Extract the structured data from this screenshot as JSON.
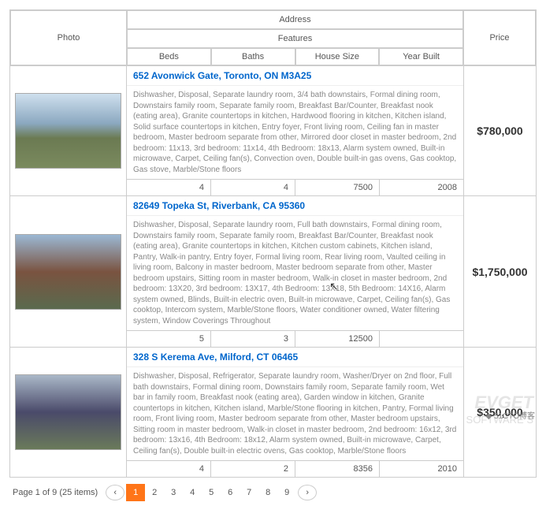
{
  "headers": {
    "photo": "Photo",
    "address": "Address",
    "features": "Features",
    "price": "Price",
    "beds": "Beds",
    "baths": "Baths",
    "house_size": "House Size",
    "year_built": "Year Built"
  },
  "listings": [
    {
      "address": "652 Avonwick Gate, Toronto, ON M3A25",
      "description": "Dishwasher, Disposal, Separate laundry room, 3/4 bath downstairs, Formal dining room, Downstairs family room, Separate family room, Breakfast Bar/Counter, Breakfast nook (eating area), Granite countertops in kitchen, Hardwood flooring in kitchen, Kitchen island, Solid surface countertops in kitchen, Entry foyer, Front living room, Ceiling fan in master bedroom, Master bedroom separate from other, Mirrored door closet in master bedroom, 2nd bedroom: 11x13, 3rd bedroom: 11x14, 4th Bedroom: 18x13, Alarm system owned, Built-in microwave, Carpet, Ceiling fan(s), Convection oven, Double built-in gas ovens, Gas cooktop, Gas stove, Marble/Stone floors",
      "beds": "4",
      "baths": "4",
      "size": "7500",
      "year": "2008",
      "price": "$780,000"
    },
    {
      "address": "82649 Topeka St, Riverbank, CA 95360",
      "description": "Dishwasher, Disposal, Separate laundry room, Full bath downstairs, Formal dining room, Downstairs family room, Separate family room, Breakfast Bar/Counter, Breakfast nook (eating area), Granite countertops in kitchen, Kitchen custom cabinets, Kitchen island, Pantry, Walk-in pantry, Entry foyer, Formal living room, Rear living room, Vaulted ceiling in living room, Balcony in master bedroom, Master bedroom separate from other, Master bedroom upstairs, Sitting room in master bedroom, Walk-in closet in master bedroom, 2nd bedroom: 13X20, 3rd bedroom: 13X17, 4th Bedroom: 13X18, 5th Bedroom: 14X16, Alarm system owned, Blinds, Built-in electric oven, Built-in microwave, Carpet, Ceiling fan(s), Gas cooktop, Intercom system, Marble/Stone floors, Water conditioner owned, Water filtering system, Window Coverings Throughout",
      "beds": "5",
      "baths": "3",
      "size": "12500",
      "year": "",
      "price": "$1,750,000"
    },
    {
      "address": "328 S Kerema Ave, Milford, CT 06465",
      "description": "Dishwasher, Disposal, Refrigerator, Separate laundry room, Washer/Dryer on 2nd floor, Full bath downstairs, Formal dining room, Downstairs family room, Separate family room, Wet bar in family room, Breakfast nook (eating area), Garden window in kitchen, Granite countertops in kitchen, Kitchen island, Marble/Stone flooring in kitchen, Pantry, Formal living room, Front living room, Master bedroom separate from other, Master bedroom upstairs, Sitting room in master bedroom, Walk-in closet in master bedroom, 2nd bedroom: 16x12, 3rd bedroom: 13x16, 4th Bedroom: 18x12, Alarm system owned, Built-in microwave, Carpet, Ceiling fan(s), Double built-in electric ovens, Gas cooktop, Marble/Stone floors",
      "beds": "4",
      "baths": "2",
      "size": "8356",
      "year": "2010",
      "price": "$350,000"
    }
  ],
  "pager": {
    "info": "Page 1 of 9 (25 items)",
    "prev": "‹",
    "next": "›",
    "pages": [
      "1",
      "2",
      "3",
      "4",
      "5",
      "6",
      "7",
      "8",
      "9"
    ],
    "active": 0
  },
  "watermark": {
    "brand": "EVGET",
    "sub": "SOFTWARE S",
    "attr": "◆ 51CTO博客"
  }
}
